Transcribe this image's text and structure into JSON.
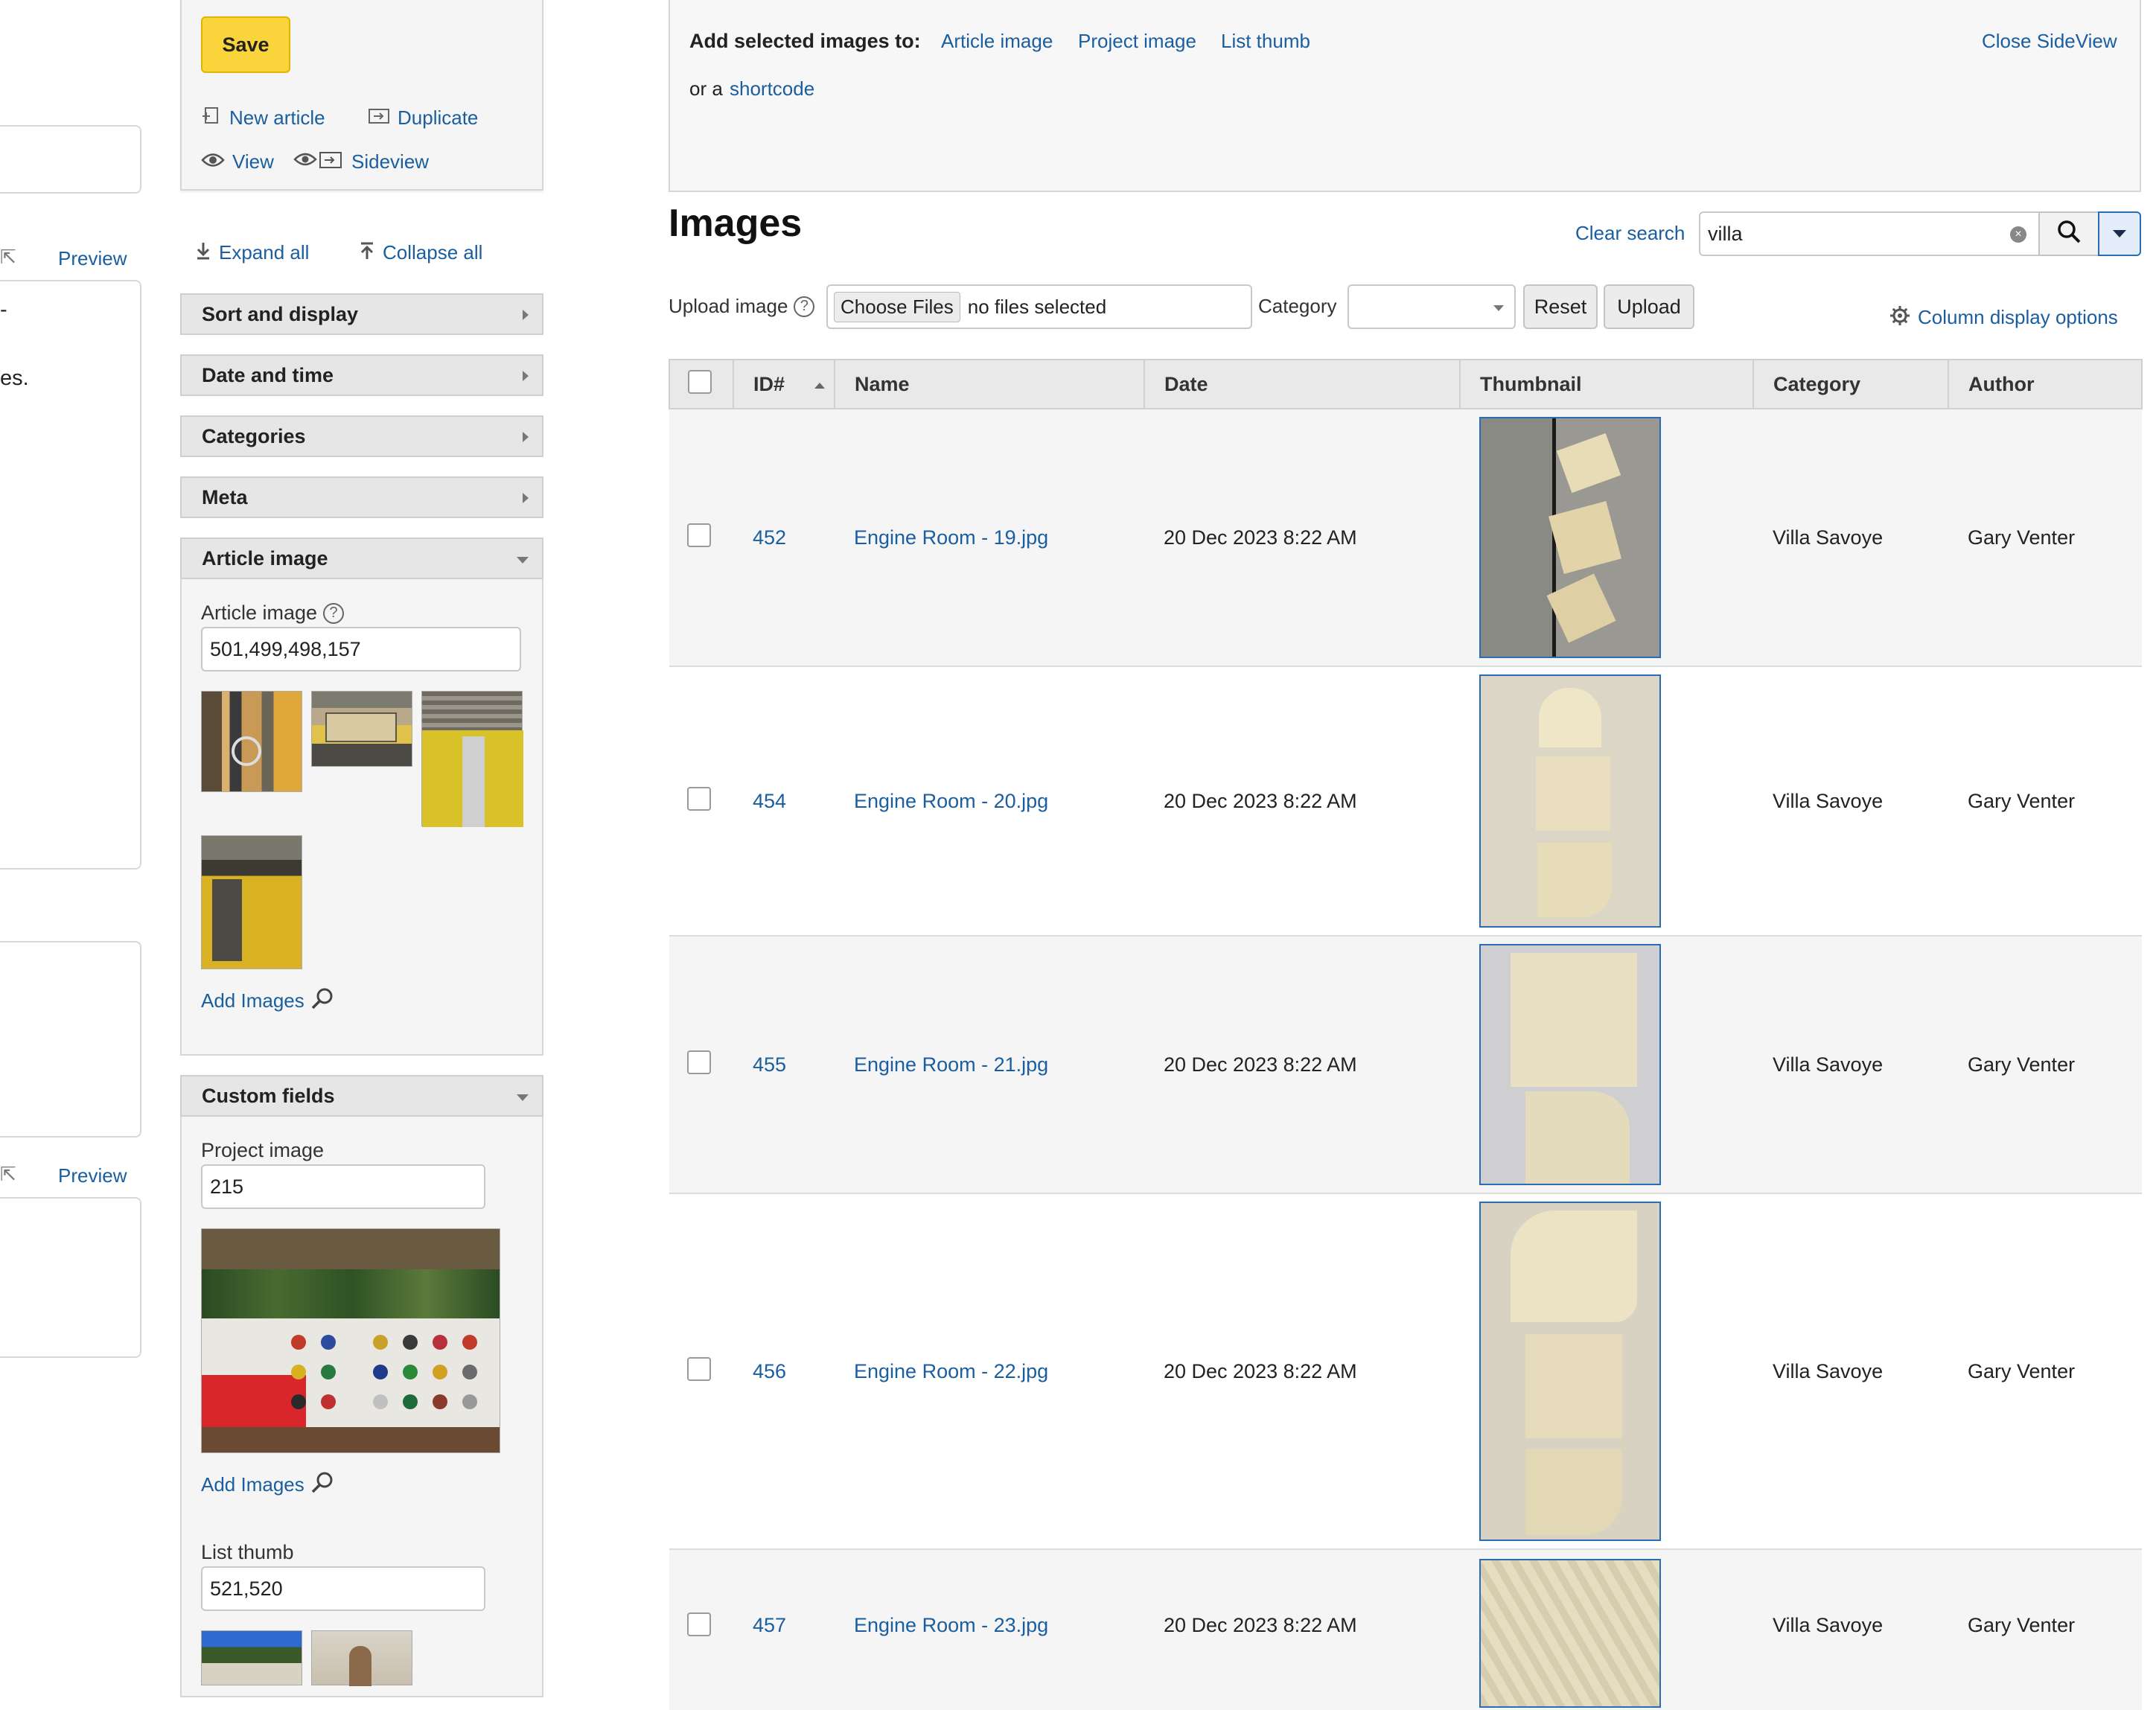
{
  "left_edge": {
    "preview_label_1": "Preview",
    "preview_label_2": "Preview",
    "text_fragment": "es."
  },
  "sidebar": {
    "save_label": "Save",
    "new_article": "New article",
    "duplicate": "Duplicate",
    "view": "View",
    "sideview": "Sideview",
    "expand_all": "Expand all",
    "collapse_all": "Collapse all",
    "sections": [
      {
        "label": "Sort and display"
      },
      {
        "label": "Date and time"
      },
      {
        "label": "Categories"
      },
      {
        "label": "Meta"
      },
      {
        "label": "Article image"
      },
      {
        "label": "Custom fields"
      }
    ],
    "article_image": {
      "label": "Article image",
      "value": "501,499,498,157",
      "add_images": "Add Images"
    },
    "custom_fields": {
      "project_image_label": "Project image",
      "project_image_value": "215",
      "add_images": "Add Images",
      "list_thumb_label": "List thumb",
      "list_thumb_value": "521,520"
    }
  },
  "topbar": {
    "add_selected_label": "Add selected images to:",
    "targets": [
      "Article image",
      "Project image",
      "List thumb"
    ],
    "or_a": "or a",
    "shortcode": "shortcode",
    "close_sideview": "Close SideView"
  },
  "images": {
    "title": "Images",
    "clear_search": "Clear search",
    "search_value": "villa",
    "upload_label": "Upload image",
    "choose_files": "Choose Files",
    "no_files": "no files selected",
    "category_label": "Category",
    "reset": "Reset",
    "upload": "Upload",
    "column_options": "Column display options",
    "columns": [
      "ID#",
      "Name",
      "Date",
      "Thumbnail",
      "Category",
      "Author"
    ],
    "rows": [
      {
        "id": "452",
        "name": "Engine Room - 19.jpg",
        "date": "20 Dec 2023 8:22 AM",
        "category": "Villa Savoye",
        "author": "Gary Venter"
      },
      {
        "id": "454",
        "name": "Engine Room - 20.jpg",
        "date": "20 Dec 2023 8:22 AM",
        "category": "Villa Savoye",
        "author": "Gary Venter"
      },
      {
        "id": "455",
        "name": "Engine Room - 21.jpg",
        "date": "20 Dec 2023 8:22 AM",
        "category": "Villa Savoye",
        "author": "Gary Venter"
      },
      {
        "id": "456",
        "name": "Engine Room - 22.jpg",
        "date": "20 Dec 2023 8:22 AM",
        "category": "Villa Savoye",
        "author": "Gary Venter"
      },
      {
        "id": "457",
        "name": "Engine Room - 23.jpg",
        "date": "20 Dec 2023 8:22 AM",
        "category": "Villa Savoye",
        "author": "Gary Venter"
      }
    ]
  },
  "colors": {
    "link": "#1a5e9f",
    "save_button": "#f9d43a",
    "thumb_border": "#2a6db5"
  }
}
